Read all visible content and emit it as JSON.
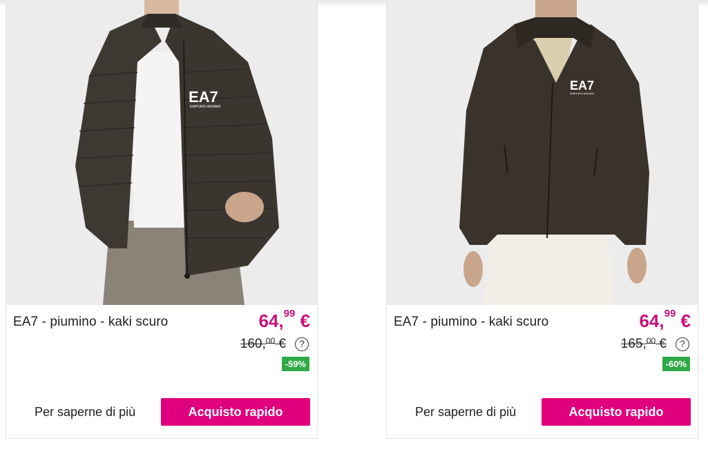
{
  "products": [
    {
      "title": "EA7 - piumino - kaki scuro",
      "price_int": "64,",
      "price_dec": "99",
      "price_cur": " €",
      "old_price_int": "160,",
      "old_price_dec": "00",
      "old_price_cur": " €",
      "discount": "-59%",
      "help_glyph": "?",
      "more_label": "Per saperne di più",
      "buy_label": "Acquisto rapido",
      "logo": "EA7",
      "logo_sub": "EMPORIO ARMANI"
    },
    {
      "title": "EA7 - piumino - kaki scuro",
      "price_int": "64,",
      "price_dec": "99",
      "price_cur": " €",
      "old_price_int": "165,",
      "old_price_dec": "00",
      "old_price_cur": " €",
      "discount": "-60%",
      "help_glyph": "?",
      "more_label": "Per saperne di più",
      "buy_label": "Acquisto rapido",
      "logo": "EA7",
      "logo_sub": "EMPORIO ARMANI"
    }
  ],
  "colors": {
    "price": "#c8117a",
    "button": "#e0007e",
    "discount_badge": "#2fa845",
    "jacket": "#3b3630"
  }
}
